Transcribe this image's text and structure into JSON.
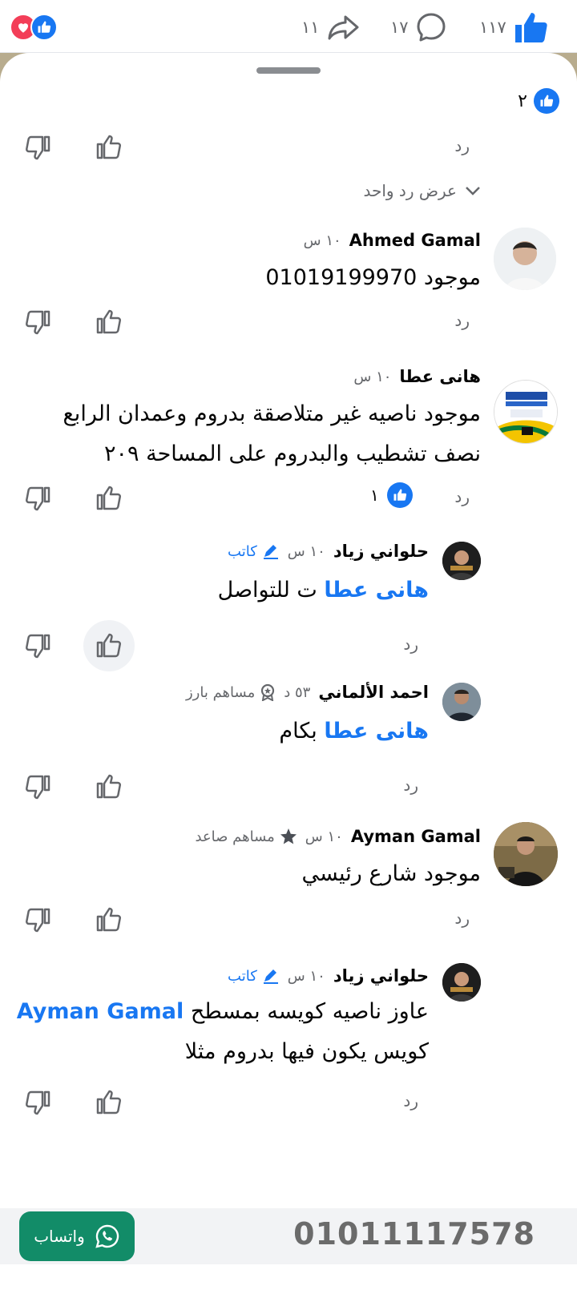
{
  "top_bar": {
    "likes_count": "١١٧",
    "comments_count": "١٧",
    "shares_count": "١١"
  },
  "thread": {
    "reaction_count": "٢",
    "show_replies": "عرض رد واحد",
    "reply_label": "رد"
  },
  "comments": [
    {
      "author": "Ahmed Gamal",
      "time": "١٠ س",
      "text": "موجود 01019199970"
    },
    {
      "author": "هانى عطا",
      "time": "١٠ س",
      "text_line1": "موجود ناصيه غير متلاصقة بدروم وعمدان الرابع",
      "text_line2": "نصف تشطيب والبدروم على المساحة ٢٠٩",
      "like_count": "١"
    },
    {
      "author": "حلواني زياد",
      "time": "١٠ س",
      "badge": "كاتب",
      "mention": "هانى عطا",
      "text": "ت للتواصل"
    },
    {
      "author": "احمد الألماني",
      "time": "٥٣ د",
      "badge": "مساهم بارز",
      "mention": "هانى عطا",
      "text": "بكام"
    },
    {
      "author": "Ayman Gamal",
      "time": "١٠ س",
      "badge": "مساهم صاعد",
      "text": "موجود شارع رئيسي"
    },
    {
      "author": "حلواني زياد",
      "time": "١٠ س",
      "badge": "كاتب",
      "mention": "Ayman Gamal",
      "text_line1": "عاوز ناصيه كويسه بمسطح",
      "text_line2": "كويس يكون فيها بدروم مثلا"
    }
  ],
  "bottom_banner": {
    "whatsapp_label": "واتساب",
    "phone": "01011117578"
  },
  "colors": {
    "facebook_blue": "#1877f2",
    "whatsapp_green": "#128c68",
    "love_red": "#f33e58"
  }
}
